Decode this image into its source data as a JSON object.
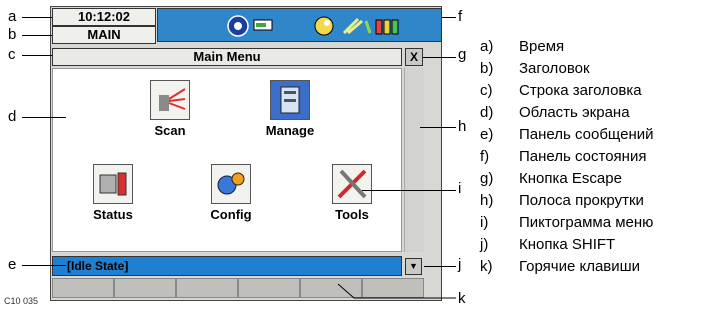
{
  "device": {
    "time": "10:12:02",
    "tab_title": "MAIN",
    "menu_title": "Main Menu",
    "escape_label": "X",
    "message": "[Idle State]",
    "shift_icon": "down-arrow",
    "hotkey_count": 6
  },
  "menu_items": [
    {
      "label": "Scan",
      "icon": "scan-icon"
    },
    {
      "label": "Manage",
      "icon": "manage-icon"
    },
    {
      "label": "Status",
      "icon": "status-icon"
    },
    {
      "label": "Config",
      "icon": "config-icon"
    },
    {
      "label": "Tools",
      "icon": "tools-icon"
    }
  ],
  "status_icons": [
    "instrument-icon",
    "battery-indicator-icon",
    "level-icon",
    "connection-icon",
    "battery-icons"
  ],
  "callout_letters": {
    "a": "a",
    "b": "b",
    "c": "c",
    "d": "d",
    "e": "e",
    "f": "f",
    "g": "g",
    "h": "h",
    "i": "i",
    "j": "j",
    "k": "k"
  },
  "legend": [
    {
      "key": "a)",
      "text": "Время"
    },
    {
      "key": "b)",
      "text": "Заголовок"
    },
    {
      "key": "c)",
      "text": "Строка заголовка"
    },
    {
      "key": "d)",
      "text": "Область экрана"
    },
    {
      "key": "e)",
      "text": "Панель сообщений"
    },
    {
      "key": "f)",
      "text": "Панель состояния"
    },
    {
      "key": "g)",
      "text": "Кнопка Escape"
    },
    {
      "key": "h)",
      "text": "Полоса прокрутки"
    },
    {
      "key": "i)",
      "text": "Пиктограмма меню"
    },
    {
      "key": "j)",
      "text": "Кнопка SHIFT"
    },
    {
      "key": "k)",
      "text": "Горячие клавиши"
    }
  ],
  "figure_id": "C10 035",
  "colors": {
    "status_bar": "#2f86c8",
    "message_bar": "#1f7fd0"
  }
}
